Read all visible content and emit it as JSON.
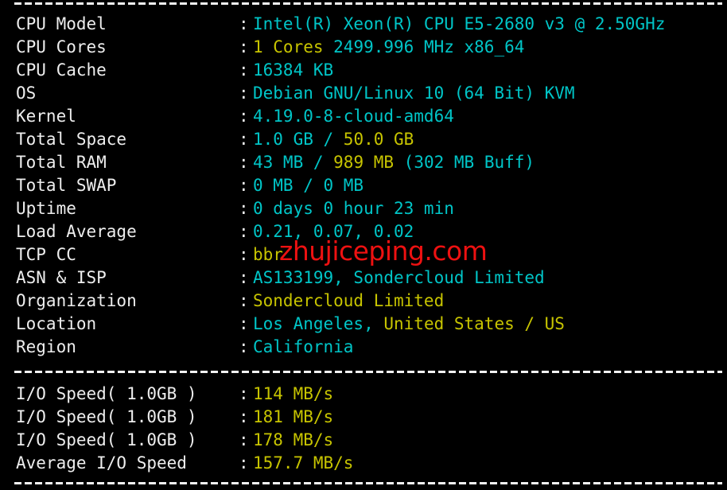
{
  "terminal": {
    "background_color": "#000000",
    "colors": {
      "label": "#eeeeee",
      "cyan": "#00c5c7",
      "yellow": "#c7c400",
      "watermark": "#ee1111"
    },
    "separator_char": "-",
    "colon": ":",
    "watermark_text": "zhujiceping.com",
    "section_system": [
      {
        "label": "CPU Model",
        "segments": [
          {
            "text": "Intel(R) Xeon(R) CPU E5-2680 v3 @ 2.50GHz",
            "color": "cyan"
          }
        ]
      },
      {
        "label": "CPU Cores",
        "segments": [
          {
            "text": "1 Cores ",
            "color": "yellow"
          },
          {
            "text": "2499.996 MHz x86_64",
            "color": "cyan"
          }
        ]
      },
      {
        "label": "CPU Cache",
        "segments": [
          {
            "text": "16384 KB",
            "color": "cyan"
          }
        ]
      },
      {
        "label": "OS",
        "segments": [
          {
            "text": "Debian GNU/Linux 10 (64 Bit) KVM",
            "color": "cyan"
          }
        ]
      },
      {
        "label": "Kernel",
        "segments": [
          {
            "text": "4.19.0-8-cloud-amd64",
            "color": "cyan"
          }
        ]
      },
      {
        "label": "Total Space",
        "segments": [
          {
            "text": "1.0 GB / ",
            "color": "cyan"
          },
          {
            "text": "50.0 GB",
            "color": "yellow"
          }
        ]
      },
      {
        "label": "Total RAM",
        "segments": [
          {
            "text": "43 MB / ",
            "color": "cyan"
          },
          {
            "text": "989 MB ",
            "color": "yellow"
          },
          {
            "text": "(302 MB Buff)",
            "color": "cyan"
          }
        ]
      },
      {
        "label": "Total SWAP",
        "segments": [
          {
            "text": "0 MB / 0 MB",
            "color": "cyan"
          }
        ]
      },
      {
        "label": "Uptime",
        "segments": [
          {
            "text": "0 days 0 hour 23 min",
            "color": "cyan"
          }
        ]
      },
      {
        "label": "Load Average",
        "segments": [
          {
            "text": "0.21, 0.07, 0.02",
            "color": "cyan"
          }
        ]
      },
      {
        "label": "TCP CC",
        "segments": [
          {
            "text": "bbr",
            "color": "yellow"
          }
        ]
      },
      {
        "label": "ASN & ISP",
        "segments": [
          {
            "text": "AS133199, Sondercloud Limited",
            "color": "cyan"
          }
        ]
      },
      {
        "label": "Organization",
        "segments": [
          {
            "text": "Sondercloud Limited",
            "color": "yellow"
          }
        ]
      },
      {
        "label": "Location",
        "segments": [
          {
            "text": "Los Angeles, ",
            "color": "cyan"
          },
          {
            "text": "United States / US",
            "color": "yellow"
          }
        ]
      },
      {
        "label": "Region",
        "segments": [
          {
            "text": "California",
            "color": "cyan"
          }
        ]
      }
    ],
    "section_io": [
      {
        "label": "I/O Speed( 1.0GB )",
        "segments": [
          {
            "text": "114 MB/s",
            "color": "yellow"
          }
        ]
      },
      {
        "label": "I/O Speed( 1.0GB )",
        "segments": [
          {
            "text": "181 MB/s",
            "color": "yellow"
          }
        ]
      },
      {
        "label": "I/O Speed( 1.0GB )",
        "segments": [
          {
            "text": "178 MB/s",
            "color": "yellow"
          }
        ]
      },
      {
        "label": "Average I/O Speed",
        "segments": [
          {
            "text": "157.7 MB/s",
            "color": "yellow"
          }
        ]
      }
    ]
  }
}
